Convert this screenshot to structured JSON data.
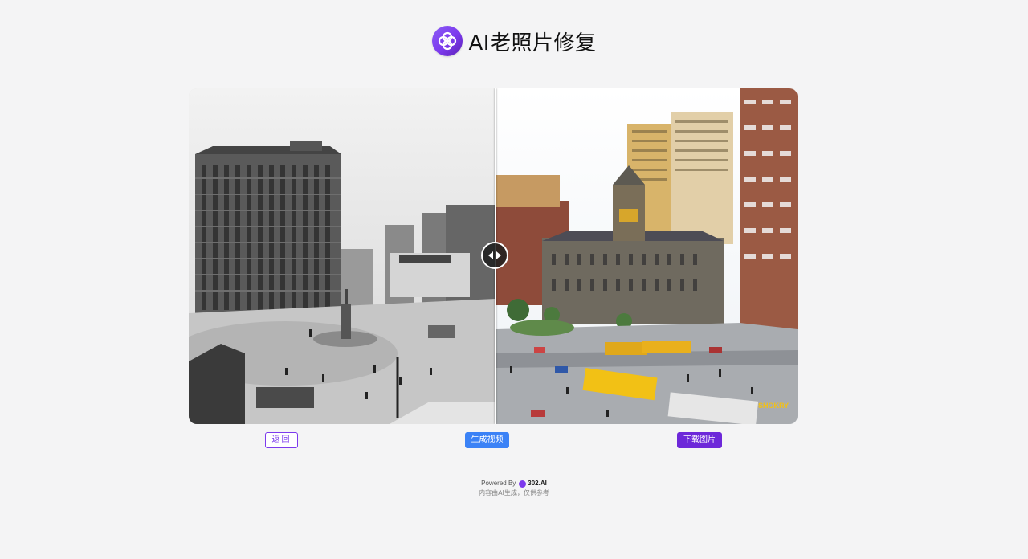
{
  "header": {
    "title": "AI老照片修复",
    "logo_icon": "clover-logo-icon"
  },
  "compare": {
    "before_label": "original-bw-photo",
    "after_label": "restored-color-photo",
    "handle_icon": "left-right-arrows-icon",
    "watermark": "SHOKRY"
  },
  "actions": {
    "back_label": "返回",
    "generate_video_label": "生成视频",
    "download_label": "下载图片"
  },
  "footer": {
    "powered_by": "Powered By",
    "brand": "302.AI",
    "disclaimer": "内容由AI生成，仅供参考"
  },
  "colors": {
    "accent": "#7c3aed",
    "video_button": "#3b82f6",
    "background": "#f4f4f5"
  }
}
